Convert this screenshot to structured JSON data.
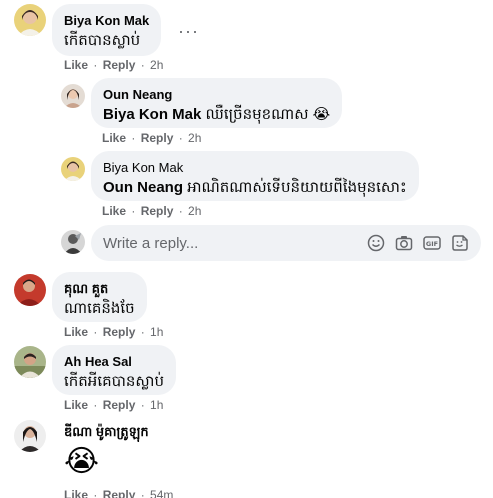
{
  "colors": {
    "bubble": "#f0f2f5",
    "muted": "#65676b",
    "text": "#050505"
  },
  "comments": [
    {
      "author": "Biya Kon Mak",
      "text": "កើតបានស្លាប់",
      "actions": {
        "like": "Like",
        "reply": "Reply",
        "time": "2h"
      },
      "more": "···",
      "avatar_icon": "woman-avatar-yellow",
      "replies": [
        {
          "author": "Oun Neang",
          "mention": "Biya Kon Mak",
          "text": "ឈឺច្រើនមុខណាស 😭",
          "actions": {
            "like": "Like",
            "reply": "Reply",
            "time": "2h"
          },
          "avatar_icon": "woman-avatar-light"
        },
        {
          "author": "Biya Kon Mak",
          "mention": "Oun Neang",
          "text": "អាណិតណាស់ទើបនិយាយពីងៃមុនសោះ",
          "actions": {
            "like": "Like",
            "reply": "Reply",
            "time": "2h"
          },
          "avatar_icon": "woman-avatar-yellow"
        }
      ],
      "reply_box": {
        "placeholder": "Write a reply...",
        "tools": [
          "emoji-icon",
          "camera-icon",
          "gif-icon",
          "sticker-icon"
        ]
      }
    },
    {
      "author": "គុណ គួត",
      "text": "ណាគេនិងចែ",
      "actions": {
        "like": "Like",
        "reply": "Reply",
        "time": "1h"
      },
      "avatar_icon": "person-avatar-red"
    },
    {
      "author": "Ah Hea Sal",
      "text": "កើតអីគេបានស្លាប់",
      "actions": {
        "like": "Like",
        "reply": "Reply",
        "time": "1h"
      },
      "avatar_icon": "person-avatar-outdoor"
    },
    {
      "author": "ឌីណា ម៉ូគាត្រូឡុក",
      "text": "😭",
      "actions": {
        "like": "Like",
        "reply": "Reply",
        "time": "54m"
      },
      "avatar_icon": "woman-avatar-dark"
    }
  ]
}
